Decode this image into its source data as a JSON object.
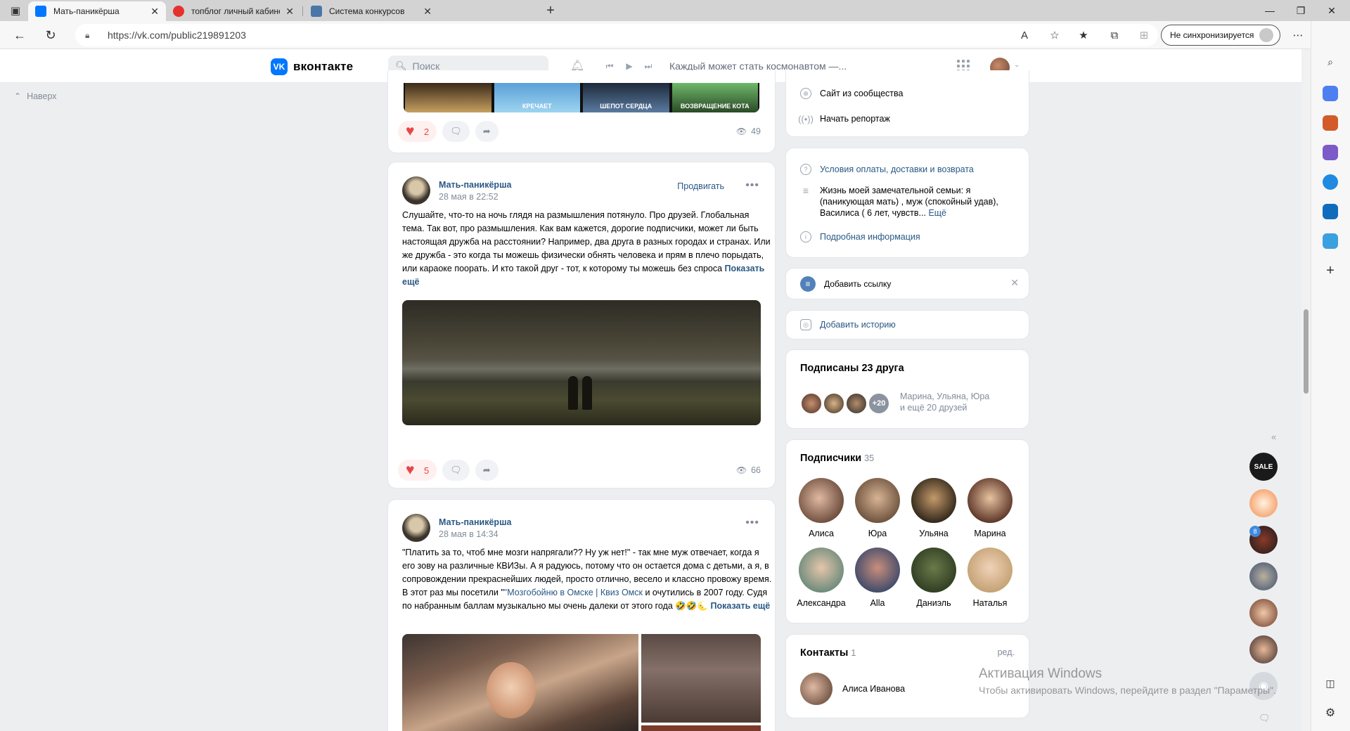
{
  "browser": {
    "tabs": [
      {
        "label": "Мать-паникёрша",
        "active": true,
        "favicon_color": "#0077ff"
      },
      {
        "label": "топблог личный кабинет — Янд",
        "active": false,
        "favicon_color": "#e5322d"
      },
      {
        "label": "Система конкурсов",
        "active": false,
        "favicon_color": "#4a76a8"
      }
    ],
    "url": "https://vk.com/public219891203",
    "sync_label": "Не синхронизируется"
  },
  "vk": {
    "logo_text": "вконтакте",
    "logo_mark": "VK",
    "search_placeholder": "Поиск",
    "now_playing": "Каждый может стать космонавтом —...",
    "back_to_top": "Наверх"
  },
  "feed": {
    "post0": {
      "films": [
        "",
        "КРЕЧАЕТ",
        "ШЕПОТ СЕРДЦА",
        "ВОЗВРАЩЕНИЕ КОТА"
      ],
      "likes": "2",
      "views": "49"
    },
    "post1": {
      "author": "Мать-паникёрша",
      "date": "28 мая в 22:52",
      "promote": "Продвигать",
      "text": "Слушайте, что-то на ночь глядя на размышления потянуло. Про друзей. Глобальная тема. Так вот, про размышления. Как вам кажется, дорогие подписчики, может ли быть настоящая дружба на расстоянии? Например, два друга в разных городах и странах. Или же дружба - это когда ты можешь физически обнять человека и прям в плечо порыдать, или караоке поорать. И кто такой друг - тот, к которому ты можешь без спроса ",
      "more": "Показать ещё",
      "likes": "5",
      "views": "66"
    },
    "post2": {
      "author": "Мать-паникёрша",
      "date": "28 мая в 14:34",
      "text_before": "\"Платить за то, чтоб мне мозги напрягали?? Ну уж нет!\" - так мне муж отвечает, когда я его зову на различные КВИЗы. А я радуюсь, потому что он остается дома с детьми, а я, в сопровождении прекраснейших людей, просто отлично, весело и классно провожу время. В этот раз мы посетили \"",
      "link": "\"Мозгобойню в Омске | Квиз Омск",
      "text_after": " и очутились в 2007 году. Судя по набранным баллам музыкально мы очень далеки от этого года 🤣🤣🌜 ",
      "more": "Показать ещё"
    }
  },
  "sidebar": {
    "block1": {
      "site": "Сайт из сообщества",
      "report": "Начать репортаж"
    },
    "block2": {
      "conditions": "Условия оплаты, доставки и возврата",
      "description": "Жизнь моей замечательной семьи: я (паникующая мать) , муж (спокойный удав), Василиса ( 6 лет, чувств...",
      "desc_more": "Ещё",
      "details": "Подробная информация"
    },
    "add_link": "Добавить ссылку",
    "add_story": "Добавить историю",
    "friends": {
      "title": "Подписаны 23 друга",
      "plus": "+20",
      "names": "Марина, Ульяна, Юра",
      "more": "и ещё 20 друзей"
    },
    "subscribers": {
      "title": "Подписчики",
      "count": "35",
      "people": [
        "Алиса",
        "Юра",
        "Ульяна",
        "Марина",
        "Александра",
        "Alla",
        "Даниэль",
        "Наталья"
      ]
    },
    "contacts": {
      "title": "Контакты",
      "count": "1",
      "edit": "ред.",
      "name": "Алиса Иванова"
    }
  },
  "rail": {
    "sale_label": "SALE",
    "badge": "8"
  },
  "windows_activation": {
    "title": "Активация Windows",
    "subtitle": "Чтобы активировать Windows, перейдите в раздел \"Параметры\"."
  }
}
